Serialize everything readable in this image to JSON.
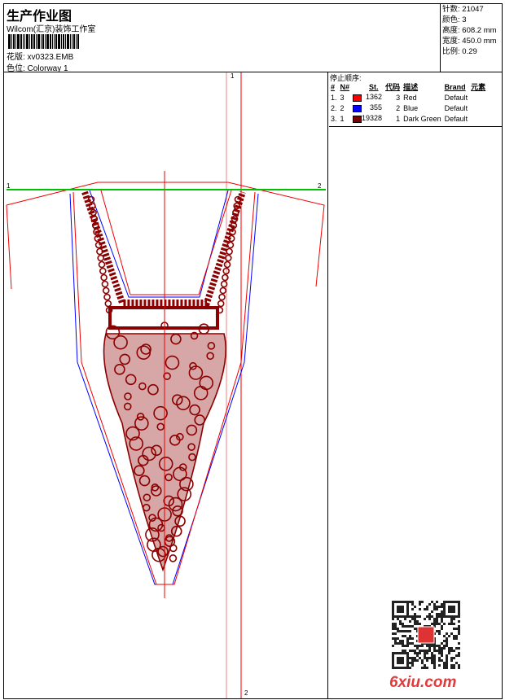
{
  "header": {
    "title": "生产作业图",
    "company": "Wilcom(汇京)装饰工作室",
    "design_label": "花版: xv0323.EMB",
    "colorway_label": "色位: Colorway 1"
  },
  "stats": [
    {
      "label": "针数",
      "value": "21047"
    },
    {
      "label": "颜色",
      "value": "3"
    },
    {
      "label": "高度",
      "value": "608.2 mm"
    },
    {
      "label": "宽度",
      "value": "450.0 mm"
    },
    {
      "label": "比例",
      "value": "0.29"
    }
  ],
  "stop_sequence": {
    "caption": "停止顺序:",
    "headers": [
      "#",
      "N#",
      "St.",
      "代码",
      "描述",
      "Brand",
      "元素"
    ],
    "rows": [
      {
        "idx": "1.",
        "n": "3",
        "color": "#ff0000",
        "stitches": "1362",
        "code": "3",
        "desc": "Red",
        "brand": "Default"
      },
      {
        "idx": "2.",
        "n": "2",
        "color": "#0000ff",
        "stitches": "355",
        "code": "2",
        "desc": "Blue",
        "brand": "Default"
      },
      {
        "idx": "3.",
        "n": "1",
        "color": "#7a0000",
        "stitches": "19328",
        "code": "1",
        "desc": "Dark Green",
        "brand": "Default"
      }
    ]
  },
  "guides": {
    "h_left": "1",
    "h_right": "2",
    "v_top": "1",
    "v_bottom": "2"
  },
  "watermark": "6xiu.com"
}
